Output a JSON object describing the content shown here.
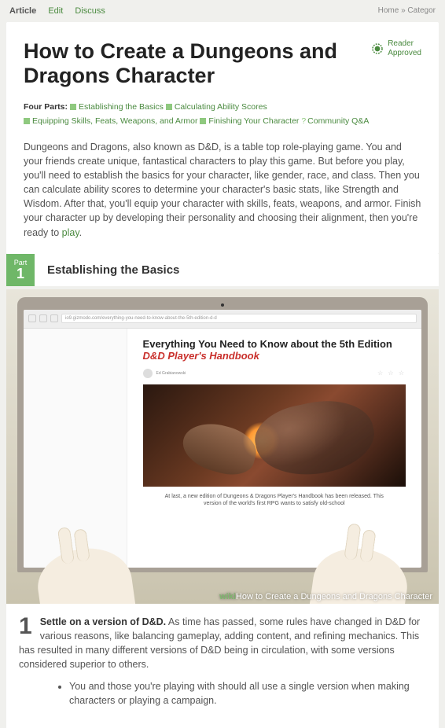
{
  "topbar": {
    "article": "Article",
    "edit": "Edit",
    "discuss": "Discuss"
  },
  "crumbs": {
    "home": "Home",
    "sep": "»",
    "categor": "Categor"
  },
  "title": "How to Create a Dungeons and Dragons Character",
  "approved": {
    "l1": "Reader",
    "l2": "Approved"
  },
  "parts": {
    "label": "Four Parts:",
    "items": [
      "Establishing the Basics",
      "Calculating Ability Scores",
      "Equipping Skills, Feats, Weapons, and Armor",
      "Finishing Your Character",
      "Community Q&A"
    ]
  },
  "intro": {
    "text": "Dungeons and Dragons, also known as D&D, is a table top role-playing game. You and your friends create unique, fantastical characters to play this game. But before you play, you'll need to establish the basics for your character, like gender, race, and class. Then you can calculate ability scores to determine your character's basic stats, like Strength and Wisdom. After that, you'll equip your character with skills, feats, weapons, and armor. Finish your character up by developing their personality and choosing their alignment, then you're ready to ",
    "link": "play",
    "dot": "."
  },
  "section": {
    "part": "Part",
    "num": "1",
    "title": "Establishing the Basics"
  },
  "illus": {
    "pageTitle": "Everything You Need to Know about the 5th Edition",
    "pageTitleEm": "D&D Player's Handbook",
    "author": "Ed Grabianowski",
    "addr": "io9.gizmodo.com/everything-you-need-to-know-about-the-5th-edition-d-d",
    "caption": "At last, a new edition of Dungeons & Dragons Player's Handbook has been released. This version of the world's first RPG wants to satisfy old-school",
    "watermark_pre": "wiki",
    "watermark_text": "How to Create a Dungeons and Dragons Character"
  },
  "step": {
    "num": "1",
    "bold": "Settle on a version of D&D.",
    "text": " As time has passed, some rules have changed in D&D for various reasons, like balancing gameplay, adding content, and refining mechanics. This has resulted in many different versions of D&D being in circulation, with some versions considered superior to others.",
    "bullet1": "You and those you're playing with should all use a single version when making characters or playing a campaign."
  }
}
